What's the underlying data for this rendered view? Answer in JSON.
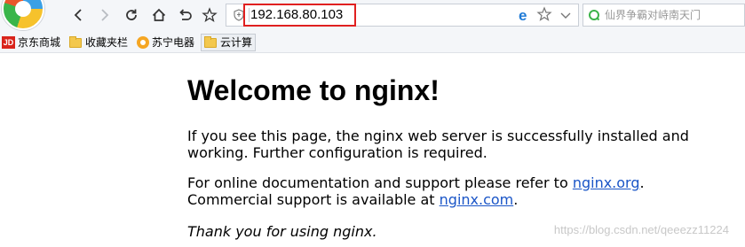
{
  "toolbar": {
    "url": "192.168.80.103",
    "search_placeholder": "仙界争霸对峙南天门"
  },
  "bookmarks": [
    {
      "icon": "jd-icon",
      "label": "京东商城",
      "badge": "JD"
    },
    {
      "icon": "folder-icon",
      "label": "收藏夹栏"
    },
    {
      "icon": "suning-icon",
      "label": "苏宁电器"
    },
    {
      "icon": "folder-icon",
      "label": "云计算"
    }
  ],
  "page": {
    "heading": "Welcome to nginx!",
    "p1_line1": "If you see this page, the nginx web server is successfully installed and",
    "p1_line2": "working. Further configuration is required.",
    "p2_before": "For online documentation and support please refer to ",
    "p2_link1": "nginx.org",
    "p2_after1": ".",
    "p2_line2_before": "Commercial support is available at ",
    "p2_link2": "nginx.com",
    "p2_after2": ".",
    "p3": "Thank you for using nginx."
  },
  "watermark": "https://blog.csdn.net/qeeezz11224"
}
